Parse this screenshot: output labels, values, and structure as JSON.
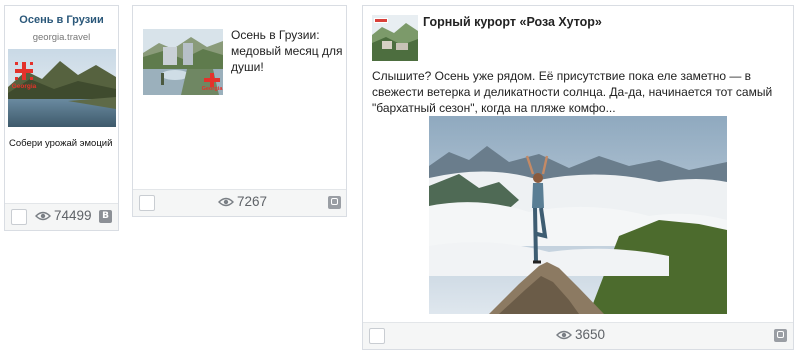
{
  "cards": [
    {
      "title": "Осень в Грузии",
      "domain": "georgia.travel",
      "logo_text": "Georgia",
      "description": "Собери урожай эмоций",
      "views": "74499",
      "source_badge": "В"
    },
    {
      "text": "Осень в Грузии: медовый месяц для души!",
      "logo_text": "Georgia",
      "views": "7267"
    },
    {
      "title": "Горный курорт «Роза Хутор»",
      "body": "Слышите? Осень уже рядом. Её присутствие пока еле заметно — в свежести ветерка и деликатности солнца. Да-да, начинается тот самый \"бархатный сезон\", когда на пляже комфо...",
      "views": "3650"
    }
  ],
  "colors": {
    "title_blue": "#2b587a",
    "logo_red": "#e4322b",
    "footer_bg": "#f5f6f6",
    "border": "#d9dde3"
  },
  "icons": [
    "eye-icon",
    "vk-badge-icon",
    "ok-badge-icon",
    "checkbox"
  ]
}
